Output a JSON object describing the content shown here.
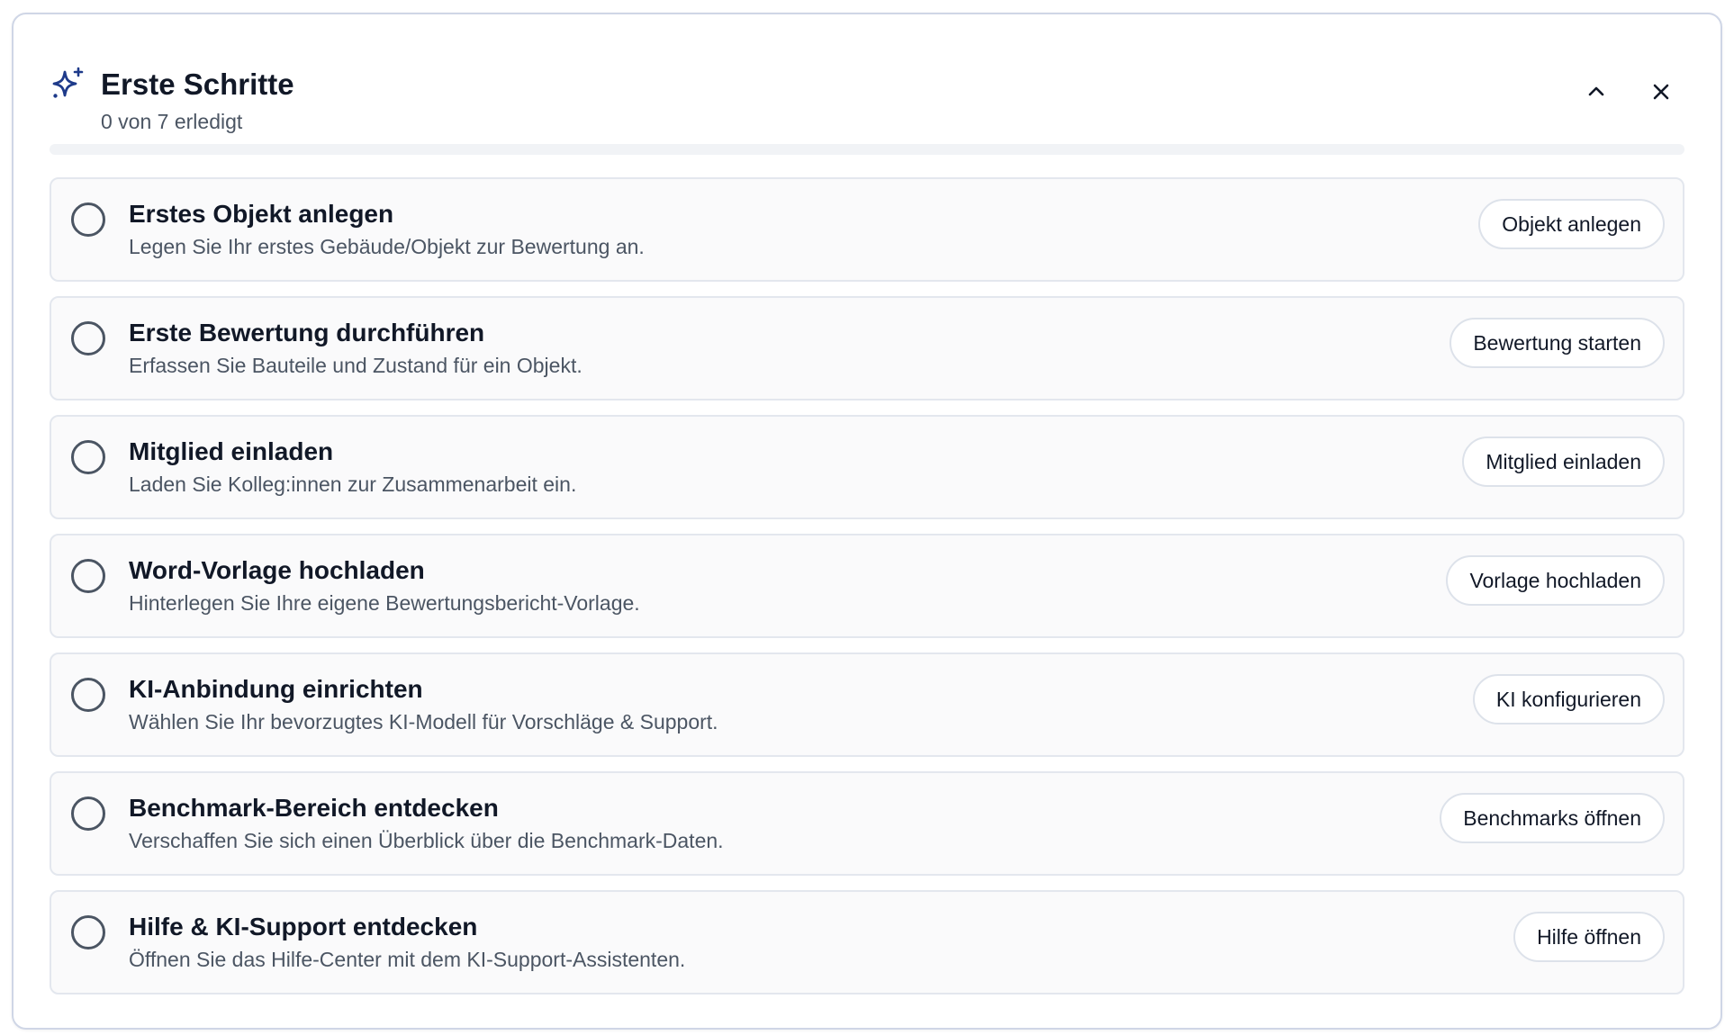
{
  "header": {
    "title": "Erste Schritte",
    "subtitle": "0 von 7 erledigt",
    "icon": "sparkles-icon",
    "collapse_icon": "chevron-up-icon",
    "close_icon": "close-icon"
  },
  "progress": {
    "completed": 0,
    "total": 7,
    "fraction": 0
  },
  "colors": {
    "accent": "#1e3a8a",
    "card_border": "#cfd6e6",
    "item_background": "#fafafb",
    "item_border": "#e3e7ee",
    "muted_text": "#4b5563"
  },
  "tasks": [
    {
      "title": "Erstes Objekt anlegen",
      "description": "Legen Sie Ihr erstes Gebäude/Objekt zur Bewertung an.",
      "action": "Objekt anlegen",
      "done": false
    },
    {
      "title": "Erste Bewertung durchführen",
      "description": "Erfassen Sie Bauteile und Zustand für ein Objekt.",
      "action": "Bewertung starten",
      "done": false
    },
    {
      "title": "Mitglied einladen",
      "description": "Laden Sie Kolleg:innen zur Zusammenarbeit ein.",
      "action": "Mitglied einladen",
      "done": false
    },
    {
      "title": "Word-Vorlage hochladen",
      "description": "Hinterlegen Sie Ihre eigene Bewertungsbericht-Vorlage.",
      "action": "Vorlage hochladen",
      "done": false
    },
    {
      "title": "KI-Anbindung einrichten",
      "description": "Wählen Sie Ihr bevorzugtes KI-Modell für Vorschläge & Support.",
      "action": "KI konfigurieren",
      "done": false
    },
    {
      "title": "Benchmark-Bereich entdecken",
      "description": "Verschaffen Sie sich einen Überblick über die Benchmark-Daten.",
      "action": "Benchmarks öffnen",
      "done": false
    },
    {
      "title": "Hilfe & KI-Support entdecken",
      "description": "Öffnen Sie das Hilfe-Center mit dem KI-Support-Assistenten.",
      "action": "Hilfe öffnen",
      "done": false
    }
  ]
}
